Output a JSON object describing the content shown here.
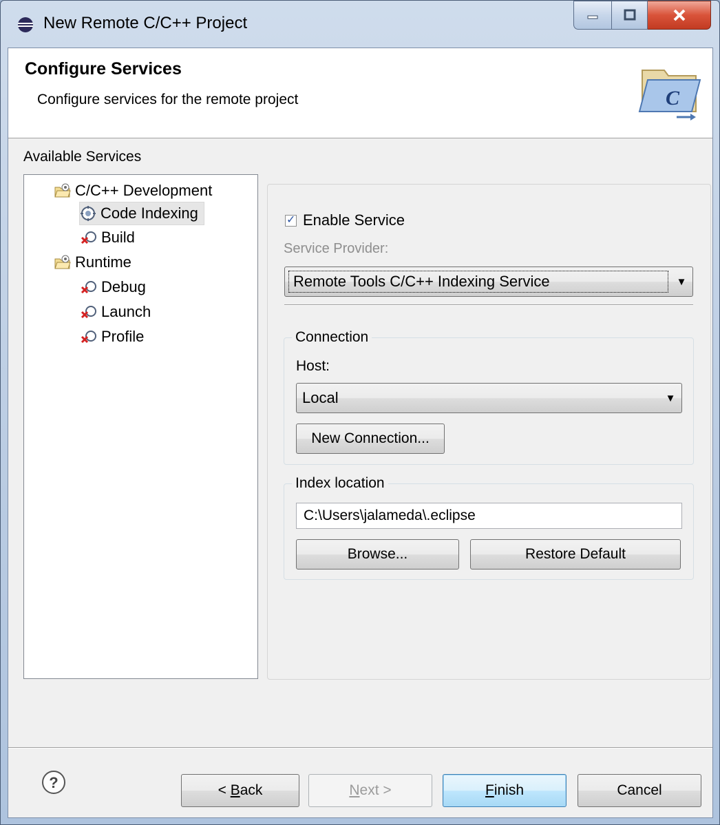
{
  "window": {
    "title": "New Remote C/C++ Project"
  },
  "header": {
    "title": "Configure Services",
    "description": "Configure services for the remote project"
  },
  "services": {
    "label": "Available Services",
    "tree": [
      {
        "label": "C/C++ Development",
        "icon": "service-category-icon"
      },
      {
        "label": "Code Indexing",
        "icon": "service-ok-icon",
        "selected": true
      },
      {
        "label": "Build",
        "icon": "service-error-icon"
      },
      {
        "label": "Runtime",
        "icon": "service-category-icon"
      },
      {
        "label": "Debug",
        "icon": "service-error-icon"
      },
      {
        "label": "Launch",
        "icon": "service-error-icon"
      },
      {
        "label": "Profile",
        "icon": "service-error-icon"
      }
    ]
  },
  "service_config": {
    "enable_label": "Enable Service",
    "enabled": true,
    "provider_label": "Service Provider:",
    "provider_value": "Remote Tools C/C++ Indexing Service",
    "connection": {
      "group_label": "Connection",
      "host_label": "Host:",
      "host_value": "Local",
      "new_connection_label": "New Connection..."
    },
    "index": {
      "group_label": "Index location",
      "path_value": "C:\\Users\\jalameda\\.eclipse",
      "browse_label": "Browse...",
      "restore_label": "Restore Default"
    }
  },
  "footer": {
    "back": {
      "prefix": "< ",
      "mnemonic": "B",
      "rest": "ack"
    },
    "next": {
      "mnemonic": "N",
      "rest": "ext >"
    },
    "finish": {
      "mnemonic": "F",
      "rest": "inish"
    },
    "cancel_label": "Cancel"
  },
  "colors": {
    "accent": "#3c7fb1",
    "error": "#d42222",
    "window_frame": "#b9cbe2"
  }
}
